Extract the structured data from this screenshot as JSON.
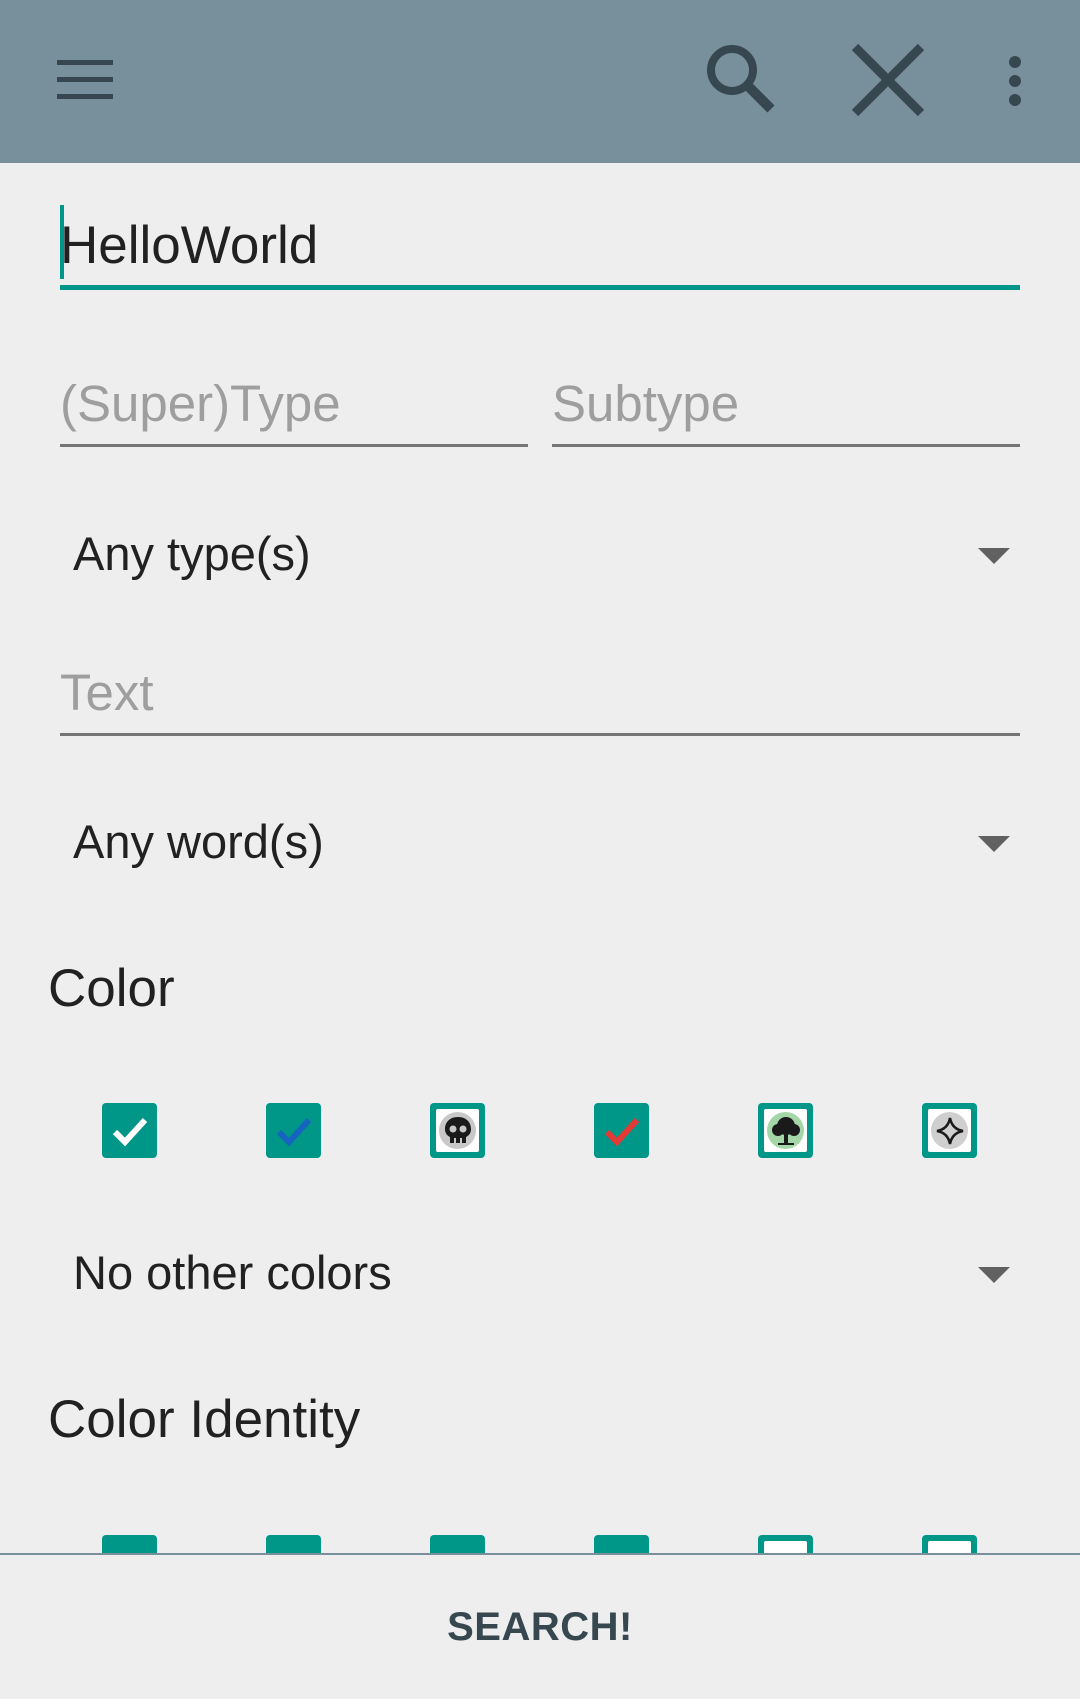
{
  "appbar": {
    "background": "#78909c",
    "icons": [
      "menu-icon",
      "search-icon",
      "close-icon",
      "overflow-menu-icon"
    ]
  },
  "form": {
    "name_value": "HelloWorld",
    "supertype_placeholder": "(Super)Type",
    "subtype_placeholder": "Subtype",
    "type_mode": "Any type(s)",
    "text_placeholder": "Text",
    "text_mode": "Any word(s)",
    "color_title": "Color",
    "color_mode": "No other colors",
    "color_identity_title": "Color Identity"
  },
  "colors": [
    {
      "name": "white",
      "state": "checked",
      "check_color": "#ffffff"
    },
    {
      "name": "blue",
      "state": "checked",
      "check_color": "#1565c0"
    },
    {
      "name": "black",
      "state": "unchecked",
      "icon": "skull-mana-icon"
    },
    {
      "name": "red",
      "state": "checked",
      "check_color": "#e53935"
    },
    {
      "name": "green",
      "state": "unchecked",
      "icon": "tree-mana-icon"
    },
    {
      "name": "colorless",
      "state": "unchecked",
      "icon": "colorless-mana-icon"
    }
  ],
  "accent_color": "#009688",
  "search_button": "SEARCH!"
}
